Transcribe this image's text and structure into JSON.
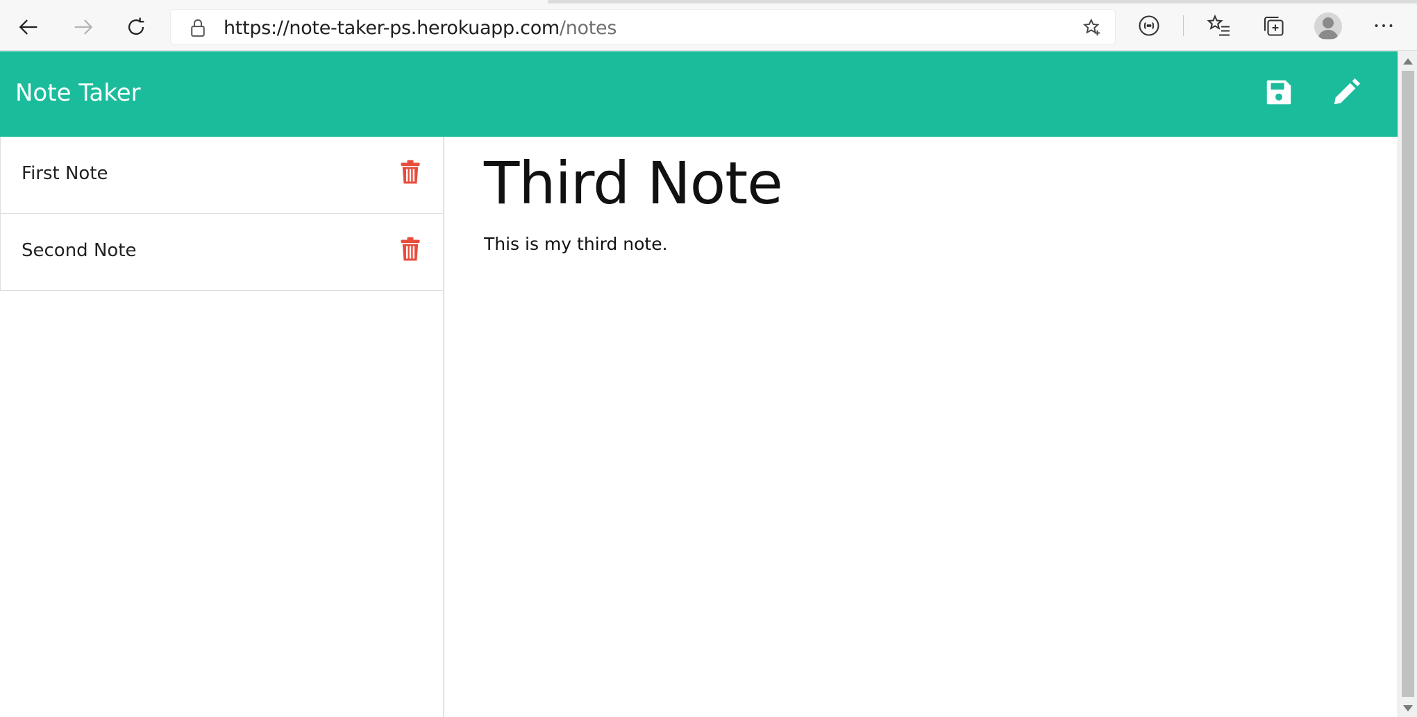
{
  "browser": {
    "url_host": "https://note-taker-ps.herokuapp.com",
    "url_path": "/notes",
    "icons": {
      "back": "arrow-left-icon",
      "forward": "arrow-right-icon",
      "refresh": "refresh-icon",
      "lock": "lock-icon",
      "favorite": "star-add-icon",
      "extension": "extension-icon",
      "favorites": "favorites-list-icon",
      "collections": "collections-icon",
      "profile": "profile-avatar-icon",
      "more": "more-dots-icon"
    }
  },
  "app": {
    "brand": "Note Taker",
    "accent_color": "#1abc9c",
    "delete_color": "#e74c3c",
    "actions": {
      "save_icon": "save-icon",
      "new_note_icon": "pencil-icon"
    }
  },
  "notes": [
    {
      "title": "First Note"
    },
    {
      "title": "Second Note"
    }
  ],
  "active_note": {
    "title": "Third Note",
    "text": "This is my third note."
  }
}
